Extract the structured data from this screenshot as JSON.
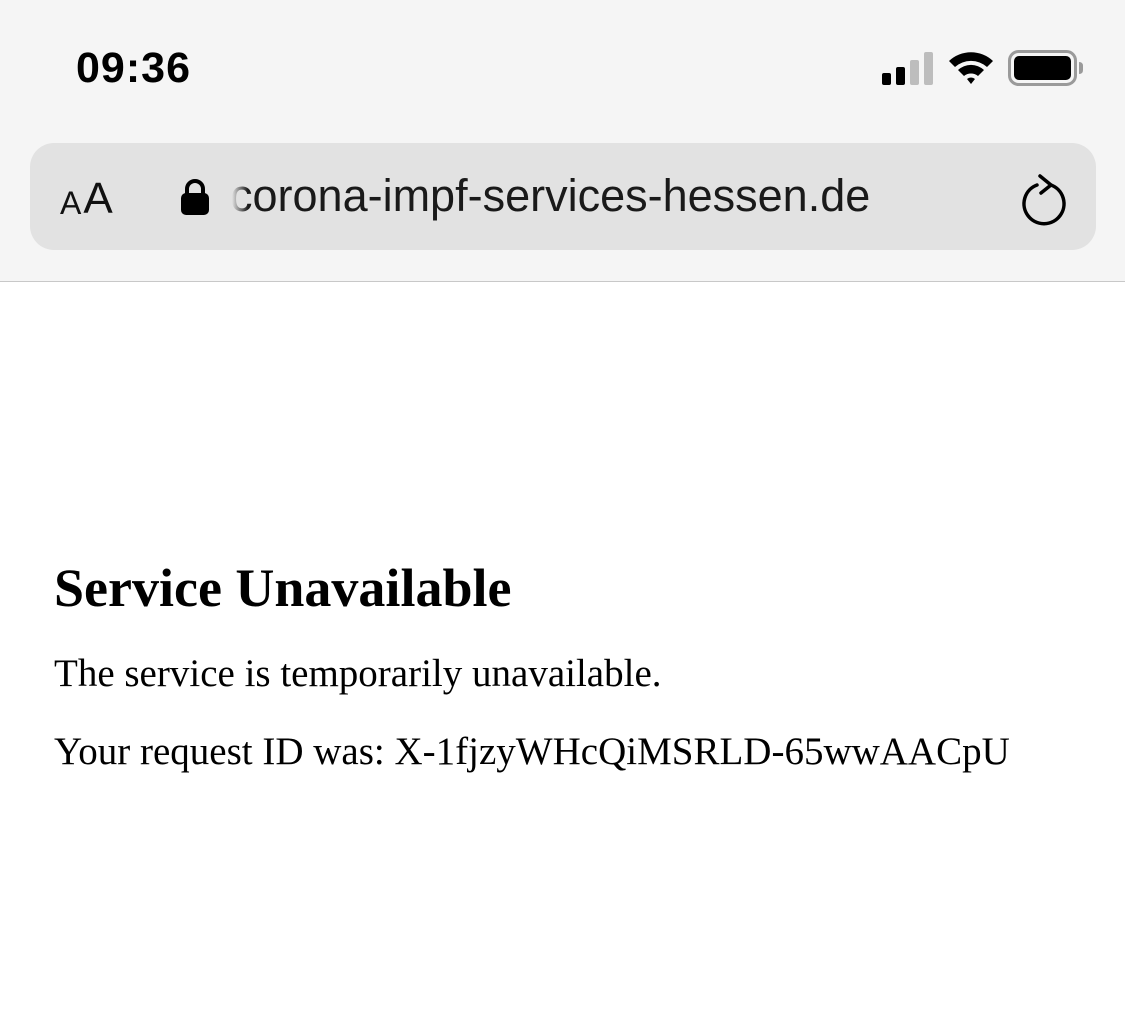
{
  "status_bar": {
    "time": "09:36",
    "signal_icon": "cellular-signal-icon",
    "wifi_icon": "wifi-icon",
    "battery_icon": "battery-icon"
  },
  "address_bar": {
    "reader_small": "A",
    "reader_large": "A",
    "lock_icon": "lock-icon",
    "url": "corona-impf-services-hessen.de",
    "reload_icon": "reload-icon"
  },
  "page": {
    "title": "Service Unavailable",
    "message": "The service is temporarily unavailable.",
    "request_id_label": "Your request ID was:",
    "request_id": "X-1fjzyWHcQiMSRLD-65wwAACpU"
  },
  "colors": {
    "chrome_bg": "#f5f5f5",
    "url_bar_bg": "#e2e2e2",
    "page_bg": "#ffffff",
    "text": "#000000"
  }
}
